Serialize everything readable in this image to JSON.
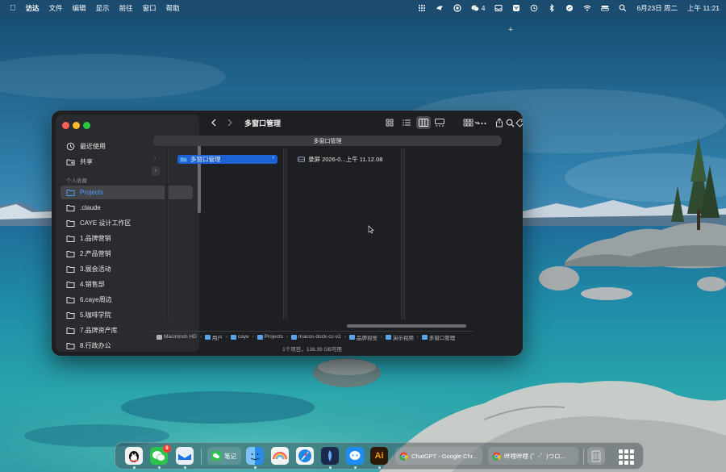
{
  "menubar": {
    "app_name": "访达",
    "menus": [
      "文件",
      "编辑",
      "显示",
      "前往",
      "窗口",
      "帮助"
    ],
    "wechat_count": "4",
    "date": "6月23日 周二",
    "time": "上午 11:21"
  },
  "finder": {
    "title": "多窗口管理",
    "tab_label": "多窗口管理",
    "sidebar": {
      "recents": "最近使用",
      "shared": "共享",
      "section_title": "个人收藏",
      "favorites": [
        "Projects",
        ".claude",
        "CAYE 设计工作区",
        "1.品牌营销",
        "2.产品营销",
        "3.展会活动",
        "4.销售部",
        "6.caye周边",
        "5.咖啡学院",
        "7.品牌资产库",
        "8.行政办公"
      ],
      "active_index": 0
    },
    "columns": {
      "col1_item": "多窗口管理",
      "col2_item": "录屏 2026-0...上午 11.12.08"
    },
    "pathbar": [
      "Macintosh HD",
      "用户",
      "caye",
      "Projects",
      "macos-dock-cc-v2",
      "品牌视觉",
      "演示视频",
      "多窗口管理"
    ],
    "status": "1个项目，138.39 GB可用"
  },
  "dock": {
    "wechat_badge": "6",
    "notes_label": "笔记",
    "ai_label": "Ai",
    "chrome_window_1": "ChatGPT - Google Chr...",
    "chrome_window_2": "哔哩哔哩 (゜-゜)つロ..."
  },
  "colors": {
    "accent": "#1d63d6",
    "folder": "#5aa2ea",
    "window_bg": "#1e1f22",
    "sidebar_bg": "#2a2b2f"
  }
}
